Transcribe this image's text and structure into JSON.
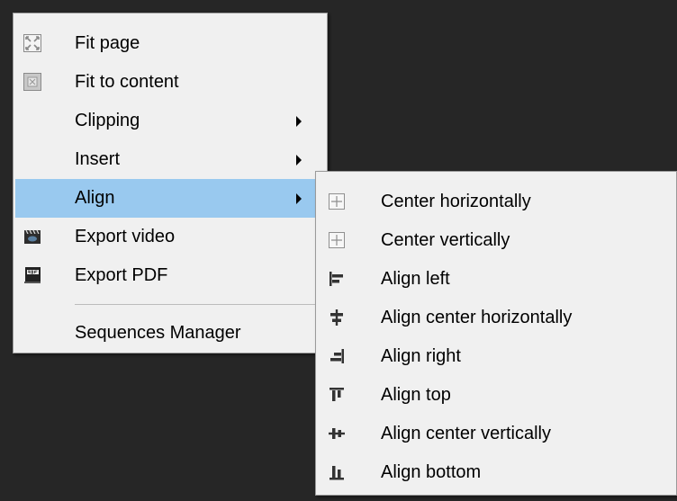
{
  "context_menu": {
    "items": [
      {
        "label": "Fit page",
        "icon": "fit-page-icon"
      },
      {
        "label": "Fit to content",
        "icon": "fit-content-icon"
      },
      {
        "label": "Clipping",
        "has_submenu": true
      },
      {
        "label": "Insert",
        "has_submenu": true
      },
      {
        "label": "Align",
        "has_submenu": true,
        "highlighted": true
      },
      {
        "label": "Export video",
        "icon": "video-clapper-icon"
      },
      {
        "label": "Export PDF",
        "icon": "pdf-icon"
      },
      {
        "label": "Sequences Manager"
      }
    ]
  },
  "align_submenu": {
    "items": [
      {
        "label": "Center horizontally",
        "icon": "center-horizontally-icon"
      },
      {
        "label": "Center vertically",
        "icon": "center-vertically-icon"
      },
      {
        "label": "Align left",
        "icon": "align-left-icon"
      },
      {
        "label": "Align center horizontally",
        "icon": "align-center-horizontal-icon"
      },
      {
        "label": "Align right",
        "icon": "align-right-icon"
      },
      {
        "label": "Align top",
        "icon": "align-top-icon"
      },
      {
        "label": "Align center vertically",
        "icon": "align-center-vertical-icon"
      },
      {
        "label": "Align bottom",
        "icon": "align-bottom-icon"
      }
    ]
  },
  "colors": {
    "background": "#262626",
    "menu_background": "#f0f0f0",
    "highlight": "#99c9ef"
  }
}
